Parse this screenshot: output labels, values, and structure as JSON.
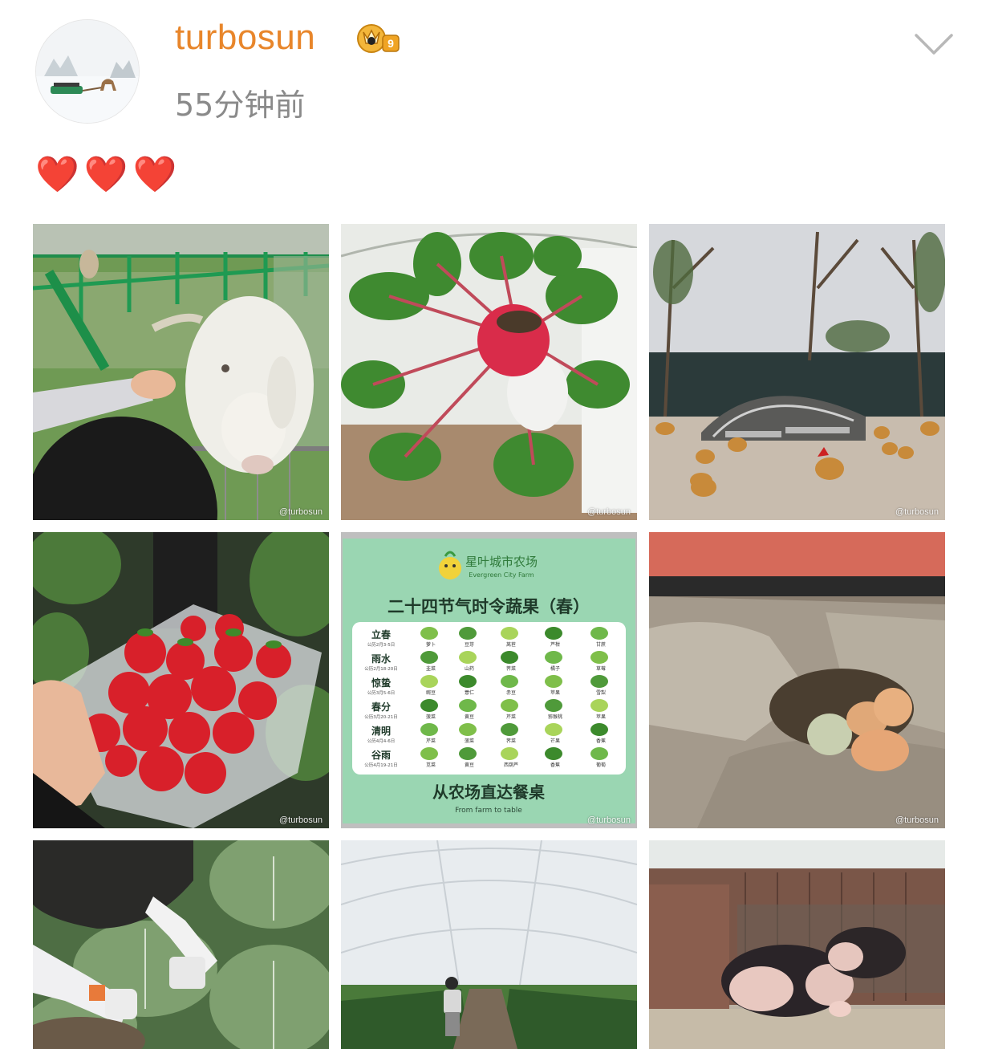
{
  "post": {
    "username": "turbosun",
    "timestamp": "55分钟前",
    "text": "❤️❤️❤️"
  },
  "icons": {
    "badge": "crown-badge-icon",
    "menu": "chevron-down-icon"
  },
  "colors": {
    "username": "#e8862b",
    "timestamp": "#8a8a8a",
    "heart": "#e2262b"
  },
  "watermark": "@turbosun",
  "sign": {
    "farm_name": "星叶城市农场",
    "farm_name_en": "Evergreen City Farm",
    "title": "二十四节气时令蔬果（春）",
    "rows": [
      {
        "term": "立春",
        "date": "公历2月3-5日",
        "items": [
          "萝卜",
          "豆芽",
          "莴苣",
          "芦柑",
          "甘蔗"
        ]
      },
      {
        "term": "雨水",
        "date": "公历2月18-20日",
        "items": [
          "韭菜",
          "山药",
          "荠菜",
          "橘子",
          "草莓"
        ]
      },
      {
        "term": "惊蛰",
        "date": "公历3月5-6日",
        "items": [
          "豌豆",
          "薏仁",
          "赤豆",
          "苹果",
          "雪梨"
        ]
      },
      {
        "term": "春分",
        "date": "公历3月20-21日",
        "items": [
          "菠菜",
          "黄豆",
          "芹菜",
          "猕猴桃",
          "苹果"
        ]
      },
      {
        "term": "清明",
        "date": "公历4月4-6日",
        "items": [
          "芹菜",
          "菠菜",
          "荠菜",
          "芒果",
          "香蕉"
        ]
      },
      {
        "term": "谷雨",
        "date": "公历4月19-21日",
        "items": [
          "苋菜",
          "黄豆",
          "西葫芦",
          "香蕉",
          "葡萄"
        ]
      }
    ],
    "footer": "从农场直达餐桌",
    "footer_en": "From farm to table"
  },
  "photos": [
    {
      "id": "goat"
    },
    {
      "id": "radish"
    },
    {
      "id": "chickens"
    },
    {
      "id": "strawberries"
    },
    {
      "id": "sign"
    },
    {
      "id": "eggs"
    },
    {
      "id": "vegetables"
    },
    {
      "id": "greenhouse"
    },
    {
      "id": "pigs"
    }
  ]
}
